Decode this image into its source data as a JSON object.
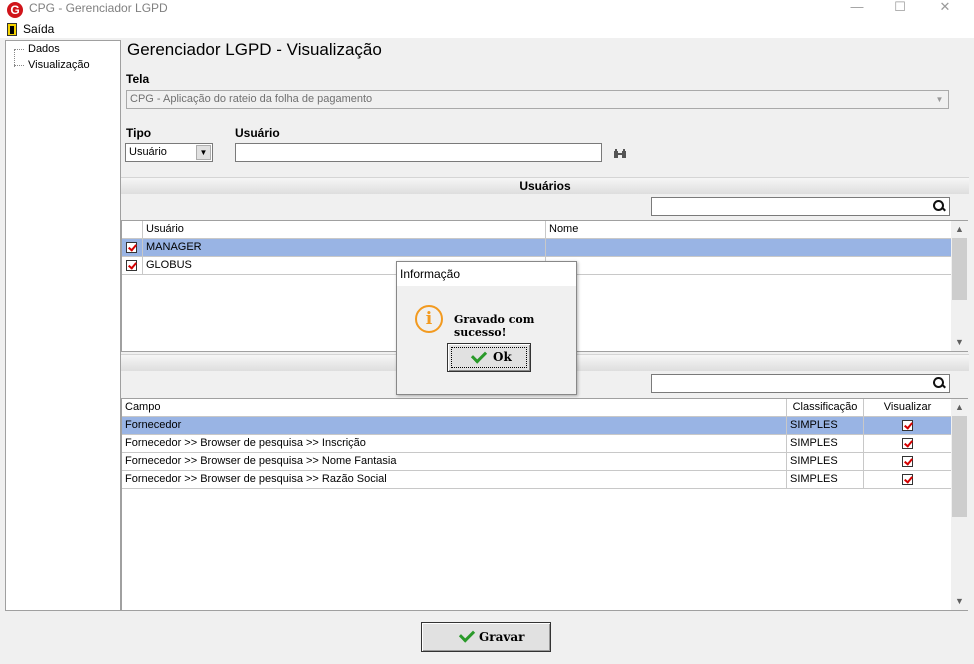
{
  "window": {
    "title": "CPG - Gerenciador LGPD",
    "logo_letter": "G",
    "minimize": "—",
    "maximize": "☐",
    "close": "✕"
  },
  "menu": {
    "exit_label": "Saída"
  },
  "tree": {
    "items": [
      {
        "label": "Dados"
      },
      {
        "label": "Visualização"
      }
    ]
  },
  "page": {
    "title": "Gerenciador LGPD - Visualização"
  },
  "tela": {
    "label": "Tela",
    "value": "CPG - Aplicação do rateio da folha de pagamento"
  },
  "tipo": {
    "label": "Tipo",
    "value": "Usuário"
  },
  "usuario_field": {
    "label": "Usuário",
    "value": ""
  },
  "usuarios_section": {
    "title": "Usuários",
    "search_value": "",
    "columns": [
      "Usuário",
      "Nome"
    ],
    "rows": [
      {
        "checked": true,
        "usuario": "MANAGER",
        "nome": "",
        "selected": true
      },
      {
        "checked": true,
        "usuario": "GLOBUS",
        "nome": "",
        "selected": false
      }
    ]
  },
  "campos_section": {
    "title": "",
    "search_value": "",
    "columns": [
      "Campo",
      "Classificação",
      "Visualizar"
    ],
    "rows": [
      {
        "campo": "Fornecedor",
        "classificacao": "SIMPLES",
        "visualizar": true,
        "selected": true
      },
      {
        "campo": "Fornecedor >> Browser de pesquisa >> Inscrição",
        "classificacao": "SIMPLES",
        "visualizar": true,
        "selected": false
      },
      {
        "campo": "Fornecedor >> Browser de pesquisa >> Nome Fantasia",
        "classificacao": "SIMPLES",
        "visualizar": true,
        "selected": false
      },
      {
        "campo": "Fornecedor >> Browser de pesquisa >> Razão Social",
        "classificacao": "SIMPLES",
        "visualizar": true,
        "selected": false
      }
    ]
  },
  "dialog": {
    "title": "Informação",
    "icon": "i",
    "message": "Gravado com sucesso!",
    "ok_label": "Ok"
  },
  "footer": {
    "save_label": "Gravar"
  },
  "colors": {
    "selection": "#99b4e4",
    "check_red": "#d40000",
    "info_orange": "#f29a20",
    "ok_green": "#2a9a2a",
    "logo_red": "#d0141a"
  }
}
